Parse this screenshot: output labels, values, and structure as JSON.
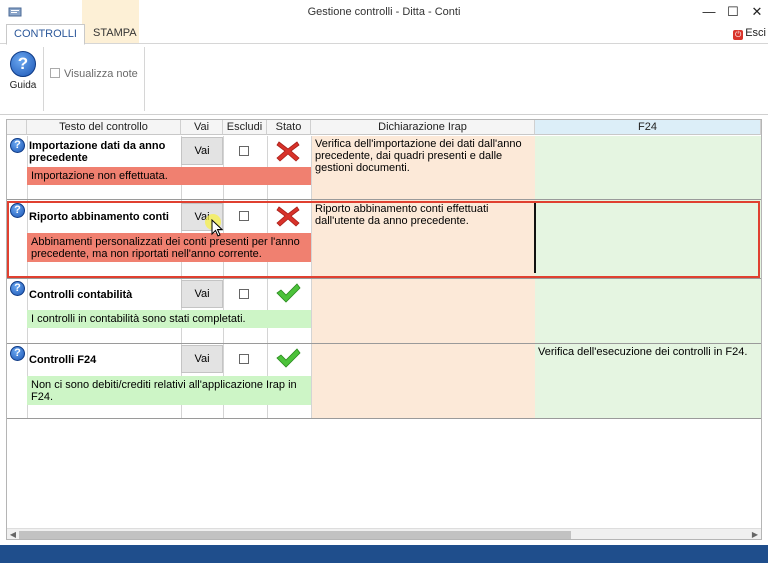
{
  "window": {
    "title": "Gestione controlli - Ditta                   - Conti",
    "minimize": "—",
    "maximize": "☐",
    "close": "✕"
  },
  "ribbon": {
    "tabs": [
      {
        "label": "CONTROLLI",
        "active": true
      },
      {
        "label": "STAMPA",
        "active": false
      }
    ],
    "esci_label": "Esci",
    "guida_label": "Guida",
    "visualizza_note_label": "Visualizza note",
    "visualizza_note_checked": false
  },
  "grid": {
    "columns": [
      "Testo del controllo",
      "Vai",
      "Escludi",
      "Stato",
      "Dichiarazione Irap",
      "F24"
    ],
    "rows": [
      {
        "title": "Importazione dati da anno precedente",
        "vai": "Vai",
        "escludi": false,
        "stato": "error",
        "note": "Importazione non effettuata.",
        "note_color": "red",
        "irap": "Verifica dell'importazione dei dati dall'anno precedente, dai quadri presenti e dalle gestioni documenti.",
        "f24": ""
      },
      {
        "title": "Riporto abbinamento conti",
        "vai": "Vai",
        "escludi": false,
        "stato": "error",
        "note": "Abbinamenti personalizzati dei conti presenti per l'anno precedente, ma non riportati nell'anno corrente.",
        "note_color": "red",
        "irap": "Riporto abbinamento conti effettuati dall'utente da anno precedente.",
        "f24": "",
        "selected": true
      },
      {
        "title": "Controlli contabilità",
        "vai": "Vai",
        "escludi": false,
        "stato": "ok",
        "note": "I controlli in contabilità sono stati completati.",
        "note_color": "green",
        "irap": "",
        "f24": ""
      },
      {
        "title": "Controlli F24",
        "vai": "Vai",
        "escludi": false,
        "stato": "ok",
        "note": "Non ci sono debiti/crediti relativi all'applicazione Irap in F24.",
        "note_color": "green",
        "irap": "",
        "f24": "Verifica dell'esecuzione dei controlli in F24."
      }
    ]
  },
  "colors": {
    "error_note": "#f08070",
    "ok_note": "#cdf5c6",
    "irap_bg": "#fce9d8",
    "f24_bg": "#e5f5e1",
    "selection_border": "#e04030"
  },
  "icons": {
    "help": "help-icon",
    "error": "red-x-icon",
    "ok": "green-check-icon"
  }
}
